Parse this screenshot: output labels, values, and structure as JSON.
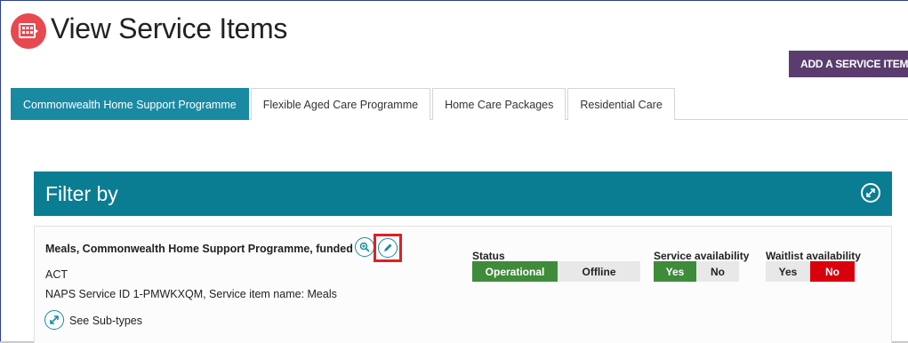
{
  "page": {
    "title": "View Service Items",
    "logo_icon": "calendar-grid-icon",
    "add_button_label": "ADD A SERVICE ITEM",
    "accent_color": "#0b7d93",
    "button_color": "#5a3d6e"
  },
  "tabs": [
    {
      "label": "Commonwealth Home Support Programme",
      "active": true
    },
    {
      "label": "Flexible Aged Care Programme",
      "active": false
    },
    {
      "label": "Home Care Packages",
      "active": false
    },
    {
      "label": "Residential Care",
      "active": false
    }
  ],
  "filter": {
    "title": "Filter by",
    "toggle_icon": "expand-arrows-icon"
  },
  "service_item": {
    "title": "Meals, Commonwealth Home Support Programme, funded",
    "state": "ACT",
    "meta": "NAPS Service ID 1-PMWKXQM, Service item name: Meals",
    "subtypes_label": "See Sub-types",
    "actions": [
      "zoom-in-icon",
      "pencil-icon"
    ],
    "status": {
      "label": "Status",
      "options": [
        "Operational",
        "Offline"
      ],
      "selected": "Operational",
      "selected_color": "#3f8b3a"
    },
    "service_availability": {
      "label": "Service availability",
      "options": [
        "Yes",
        "No"
      ],
      "selected": "Yes",
      "selected_color": "#3f8b3a"
    },
    "waitlist_availability": {
      "label": "Waitlist availability",
      "options": [
        "Yes",
        "No"
      ],
      "selected": "No",
      "selected_color": "#d9000d"
    }
  }
}
